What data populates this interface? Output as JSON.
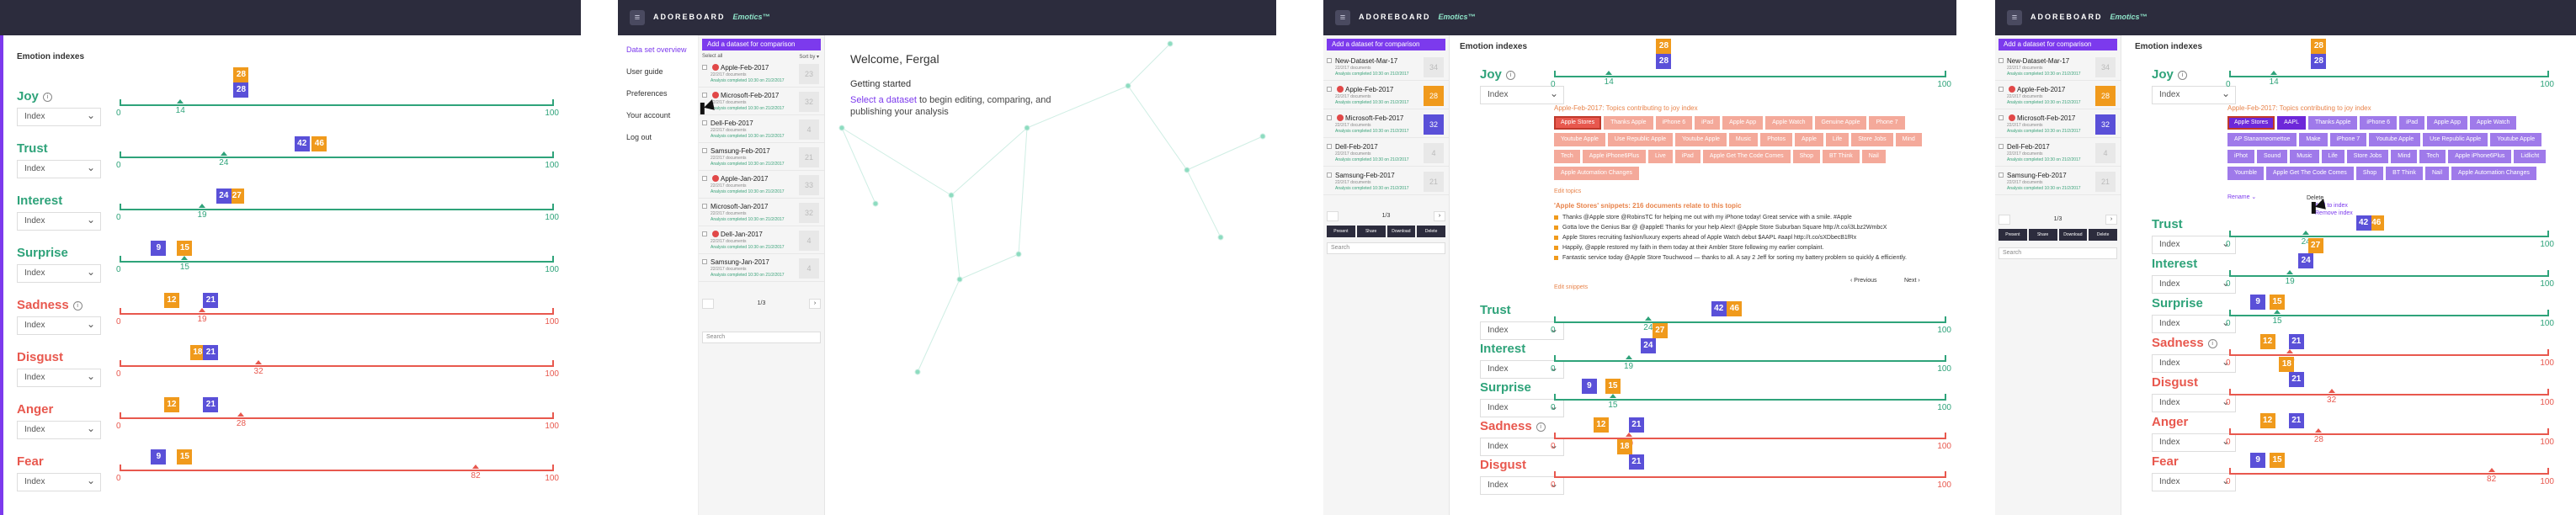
{
  "brand": {
    "name": "ADOREBOARD",
    "product": "Emotics™"
  },
  "section_title": "Emotion indexes",
  "select_default": "Index",
  "scale": {
    "min": "0",
    "max": "100"
  },
  "colors": {
    "positive": "#2fa37a",
    "negative": "#e8584e",
    "orange_flag": "#f09a1c",
    "purple_flag": "#5a50d8",
    "accent": "#7c3aed"
  },
  "panel1": {
    "emotions": [
      {
        "name": "Joy",
        "info": true,
        "value": "14",
        "orange": "28",
        "purple": "28",
        "tone": "positive"
      },
      {
        "name": "Trust",
        "info": false,
        "value": "24",
        "orange": "46",
        "purple": "42",
        "tone": "positive"
      },
      {
        "name": "Interest",
        "info": false,
        "value": "19",
        "orange": "27",
        "purple": "24",
        "tone": "positive"
      },
      {
        "name": "Surprise",
        "info": false,
        "value": "15",
        "orange": "15",
        "purple": "9",
        "tone": "positive"
      },
      {
        "name": "Sadness",
        "info": true,
        "value": "19",
        "orange": "12",
        "purple": "21",
        "tone": "negative"
      },
      {
        "name": "Disgust",
        "info": false,
        "value": "32",
        "orange": "18",
        "purple": "21",
        "tone": "negative"
      },
      {
        "name": "Anger",
        "info": false,
        "value": "28",
        "orange": "12",
        "purple": "21",
        "tone": "negative"
      },
      {
        "name": "Fear",
        "info": false,
        "value": "82",
        "orange": "15",
        "purple": "9",
        "tone": "negative"
      }
    ]
  },
  "panel2": {
    "menu": [
      "Data set overview",
      "User guide",
      "Preferences",
      "Your account",
      "Log out"
    ],
    "add_dataset": "Add a dataset for comparison",
    "select_all": "Select all",
    "sort_by": "Sort by ▾",
    "datasets": [
      {
        "name": "Apple-Feb-2017",
        "meta": "22/2/17 documents",
        "ok": "Analysis completed 10:30 on 21/2/2017",
        "score": "23",
        "error": true
      },
      {
        "name": "Microsoft-Feb-2017",
        "meta": "22/2/17 documents",
        "ok": "Analysis completed 10:30 on 21/2/2017",
        "score": "32",
        "error": true
      },
      {
        "name": "Dell-Feb-2017",
        "meta": "22/2/17 documents",
        "ok": "Analysis completed 10:30 on 21/2/2017",
        "score": "4",
        "error": false
      },
      {
        "name": "Samsung-Feb-2017",
        "meta": "22/2/17 documents",
        "ok": "Analysis completed 10:30 on 21/2/2017",
        "score": "21",
        "error": false
      },
      {
        "name": "Apple-Jan-2017",
        "meta": "22/2/17 documents",
        "ok": "Analysis completed 10:30 on 21/2/2017",
        "score": "33",
        "error": true
      },
      {
        "name": "Microsoft-Jan-2017",
        "meta": "22/2/17 documents",
        "ok": "Analysis completed 10:30 on 21/2/2017",
        "score": "32",
        "error": false
      },
      {
        "name": "Dell-Jan-2017",
        "meta": "22/2/17 documents",
        "ok": "Analysis completed 10:30 on 21/2/2017",
        "score": "4",
        "error": true
      },
      {
        "name": "Samsung-Jan-2017",
        "meta": "22/2/17 documents",
        "ok": "Analysis completed 10:30 on 21/2/2017",
        "score": "4",
        "error": false
      }
    ],
    "page": "1/3",
    "search_placeholder": "Search",
    "welcome": "Welcome, Fergal",
    "getting_started": "Getting started",
    "select_link": "Select a dataset",
    "getting_body": " to begin editing, comparing, and publishing your analysis"
  },
  "panel3": {
    "add_dataset": "Add a dataset for comparison",
    "datasets": [
      {
        "name": "New-Dataset-Mar-17",
        "meta": "22/2/17 documents",
        "ok": "Analysis completed 10:30 on 21/2/2017",
        "score": "34",
        "error": false,
        "style": "grey"
      },
      {
        "name": "Apple-Feb-2017",
        "meta": "22/2/17 documents",
        "ok": "Analysis completed 10:30 on 21/2/2017",
        "score": "28",
        "error": true,
        "style": "orange"
      },
      {
        "name": "Microsoft-Feb-2017",
        "meta": "22/2/17 documents",
        "ok": "Analysis completed 10:30 on 21/2/2017",
        "score": "32",
        "error": true,
        "style": "purple"
      },
      {
        "name": "Dell-Feb-2017",
        "meta": "22/2/17 documents",
        "ok": "Analysis completed 10:30 on 21/2/2017",
        "score": "4",
        "error": false,
        "style": "grey"
      },
      {
        "name": "Samsung-Feb-2017",
        "meta": "22/2/17 documents",
        "ok": "Analysis completed 10:30 on 21/2/2017",
        "score": "21",
        "error": false,
        "style": "grey"
      }
    ],
    "page": "1/3",
    "actions": [
      "Present",
      "Share",
      "Download",
      "Delete"
    ],
    "search_placeholder": "Search",
    "topics_title": "Apple-Feb-2017: Topics contributing to joy index",
    "topics": [
      "Apple Stores",
      "Thanks Apple",
      "iPhone 6",
      "iPad",
      "Apple App",
      "Apple Watch",
      "Genuine Apple",
      "Phone 7",
      "Youtube Apple",
      "Use Republic Apple",
      "Youtube Apple",
      "Music",
      "Photos",
      "Apple",
      "Life",
      "Store Jobs",
      "Mind",
      "Tech",
      "Apple iPhone6Plus",
      "Live",
      "iPad",
      "Apple Get The Code Comes",
      "Shop",
      "BT Think",
      "Nail",
      "Apple Automation Changes"
    ],
    "edit_topics": "Edit topics",
    "snippets_title": "'Apple Stores' snippets: 216 documents relate to this topic",
    "snippets": [
      "Thanks @Apple store @RobinsTC for helping me out with my iPhone today! Great service with a smile. #Apple",
      "Gotta love the Genius Bar @ @appleE Thanks for your help Alex!! @Apple Store Suburban Square http://t.co/i3Lbz2WmbcX",
      "Apple Stores recruiting fashion/luxury experts ahead of Apple Watch debut $AAPL #aapl http://t.co/sXDbecB1fRx",
      "Happily, @apple restored my faith in them today at their Ambler Store following my earlier complaint.",
      "Fantastic service today @Apple Store Touchwood — thanks to all. A say 2 Jeff for sorting my battery problem so quickly & efficiently."
    ],
    "prev": "‹ Previous",
    "next": "Next ›",
    "edit_snippets": "Edit snippets",
    "emotions": [
      {
        "name": "Joy",
        "info": true,
        "value": "14",
        "orange": "28",
        "purple": "28",
        "tone": "positive"
      },
      {
        "name": "Trust",
        "info": false,
        "value": "24",
        "orange": "46",
        "purple": "42",
        "tone": "positive"
      },
      {
        "name": "Interest",
        "info": false,
        "value": "19",
        "orange": "27",
        "purple": "24",
        "tone": "positive"
      },
      {
        "name": "Surprise",
        "info": false,
        "value": "15",
        "orange": "15",
        "purple": "9",
        "tone": "positive"
      },
      {
        "name": "Sadness",
        "info": true,
        "value": "19",
        "orange": "12",
        "purple": "21",
        "tone": "negative"
      },
      {
        "name": "Disgust",
        "info": false,
        "value": "",
        "orange": "18",
        "purple": "21",
        "tone": "negative"
      }
    ]
  },
  "panel4": {
    "topics": [
      "Apple Stores",
      "AAPL",
      "Thanks Apple",
      "iPhone 6",
      "iPad",
      "Apple App",
      "Apple Watch",
      "AP Stananneomettoe",
      "Make",
      "iPhone 7",
      "Youtube Apple",
      "Use Republic Apple",
      "Youtube Apple",
      "iPhot",
      "Sound",
      "Music",
      "Life",
      "Store Jobs",
      "Mind",
      "Tech",
      "Apple iPhone6Plus",
      "Lidlicht",
      "Youmble",
      "Apple Get The Code Comes",
      "Shop",
      "BT Think",
      "Nail",
      "Apple Automation Changes"
    ],
    "rename": "Rename ⌄",
    "menu": [
      "Delete",
      "Add to index",
      "Remove index"
    ],
    "emotions": [
      {
        "name": "Joy",
        "info": true,
        "value": "14",
        "orange": "28",
        "purple": "28",
        "tone": "positive"
      },
      {
        "name": "Trust",
        "info": false,
        "value": "24",
        "orange": "46",
        "purple": "42",
        "tone": "positive"
      },
      {
        "name": "Interest",
        "info": false,
        "value": "19",
        "orange": "27",
        "purple": "24",
        "tone": "positive"
      },
      {
        "name": "Surprise",
        "info": false,
        "value": "15",
        "orange": "15",
        "purple": "9",
        "tone": "positive"
      },
      {
        "name": "Sadness",
        "info": true,
        "value": "19",
        "orange": "12",
        "purple": "21",
        "tone": "negative"
      },
      {
        "name": "Disgust",
        "info": false,
        "value": "32",
        "orange": "18",
        "purple": "21",
        "tone": "negative"
      },
      {
        "name": "Anger",
        "info": false,
        "value": "28",
        "orange": "12",
        "purple": "21",
        "tone": "negative"
      },
      {
        "name": "Fear",
        "info": false,
        "value": "82",
        "orange": "15",
        "purple": "9",
        "tone": "negative"
      }
    ]
  }
}
